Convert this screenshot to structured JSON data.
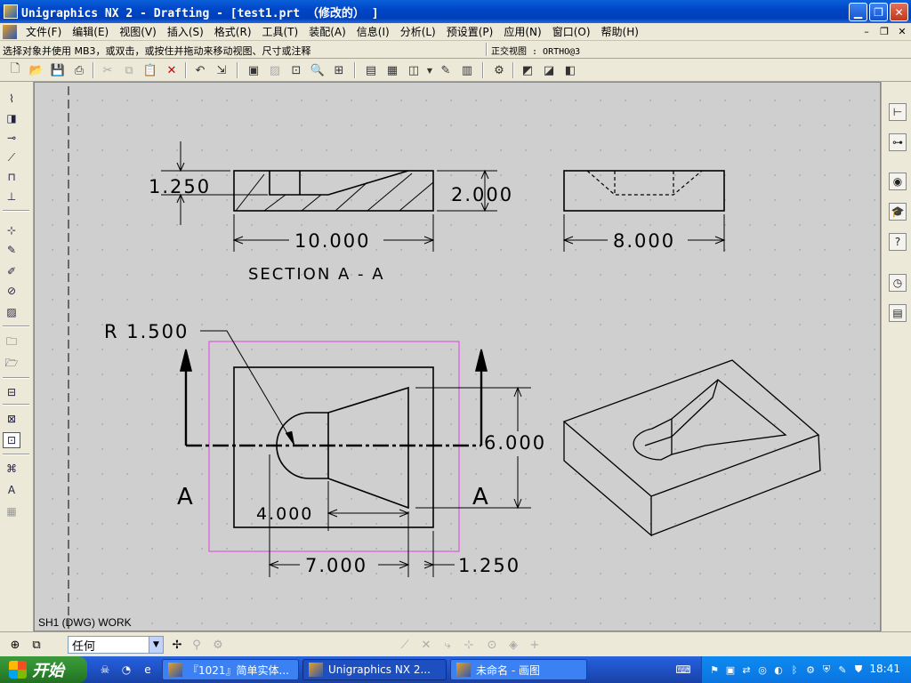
{
  "window": {
    "title": "Unigraphics NX 2 - Drafting - [test1.prt （修改的） ]"
  },
  "menubar": {
    "items": [
      "文件(F)",
      "编辑(E)",
      "视图(V)",
      "插入(S)",
      "格式(R)",
      "工具(T)",
      "装配(A)",
      "信息(I)",
      "分析(L)",
      "预设置(P)",
      "应用(N)",
      "窗口(O)",
      "帮助(H)"
    ]
  },
  "cue": "选择对象并使用 MB3，或双击，或按住并拖动来移动视图、尺寸或注释",
  "view_status": "正交视图 : ORTHO@3",
  "drawing": {
    "section_label": "SECTION  A - A",
    "dims": {
      "d1250_left": "1.250",
      "d2000": "2.000",
      "d10000": "10.000",
      "d8000": "8.000",
      "radius": "R 1.500",
      "d6000": "6.000",
      "d4000": "4.000",
      "d7000": "7.000",
      "d1250_bottom": "1.250",
      "section_a_left": "A",
      "section_a_right": "A"
    }
  },
  "sheet_status": "SH1 (DWG) WORK",
  "selection": {
    "filter_value": "任何"
  },
  "taskbar": {
    "start_label": "开始",
    "tasks": [
      "『1021』简单实体...",
      "Unigraphics NX 2...",
      "未命名 - 画图"
    ],
    "clock": "18:41"
  },
  "colors": {
    "title_blue": "#0046c8",
    "taskbar_blue": "#245edb",
    "start_green": "#2e8b2e",
    "view_border": "#e040e0"
  }
}
